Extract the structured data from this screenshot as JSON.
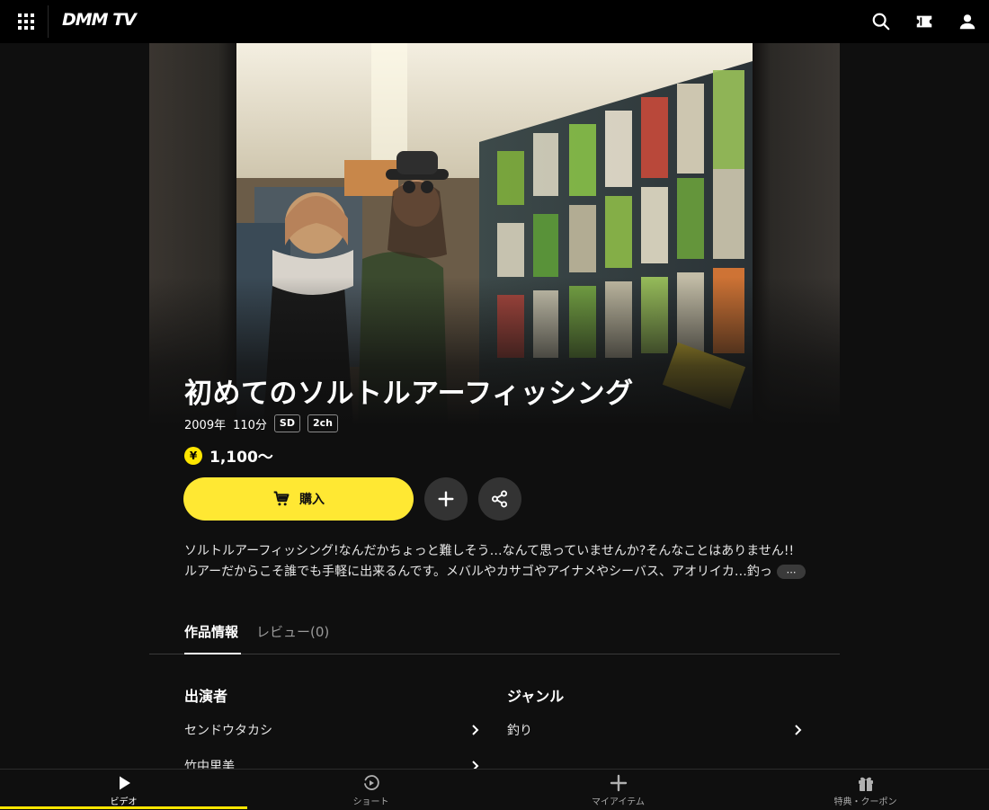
{
  "header": {
    "logo": "DMM TV",
    "icons": [
      "menu-grid-icon",
      "search-icon",
      "ticket-icon",
      "user-icon"
    ]
  },
  "title": {
    "main": "初めてのソルトルアーフィッシング",
    "year": "2009年",
    "duration": "110分",
    "badges": [
      "SD",
      "2ch"
    ]
  },
  "price": {
    "currency_symbol": "¥",
    "value": "1,100〜"
  },
  "actions": {
    "buy_label": "購入",
    "add_icon": "plus-icon",
    "share_icon": "share-icon"
  },
  "description": {
    "line1": "ソルトルアーフィッシング!なんだかちょっと難しそう…なんて思っていませんか?そんなことはありません!!",
    "line2": "ルアーだからこそ誰でも手軽に出来るんです。メバルやカサゴやアイナメやシーバス、アオリイカ…釣っ",
    "more_label": "⋯"
  },
  "tabs": {
    "info": "作品情報",
    "review": "レビュー(0)"
  },
  "cast": {
    "title": "出演者",
    "items": [
      "センドウタカシ",
      "竹中里美"
    ]
  },
  "genre": {
    "title": "ジャンル",
    "items": [
      "釣り"
    ]
  },
  "bottom_nav": {
    "video": "ビデオ",
    "short": "ショート",
    "my_items": "マイアイテム",
    "perks": "特典・クーポン"
  },
  "colors": {
    "accent": "#ffe833",
    "background": "#0f0f0f"
  }
}
